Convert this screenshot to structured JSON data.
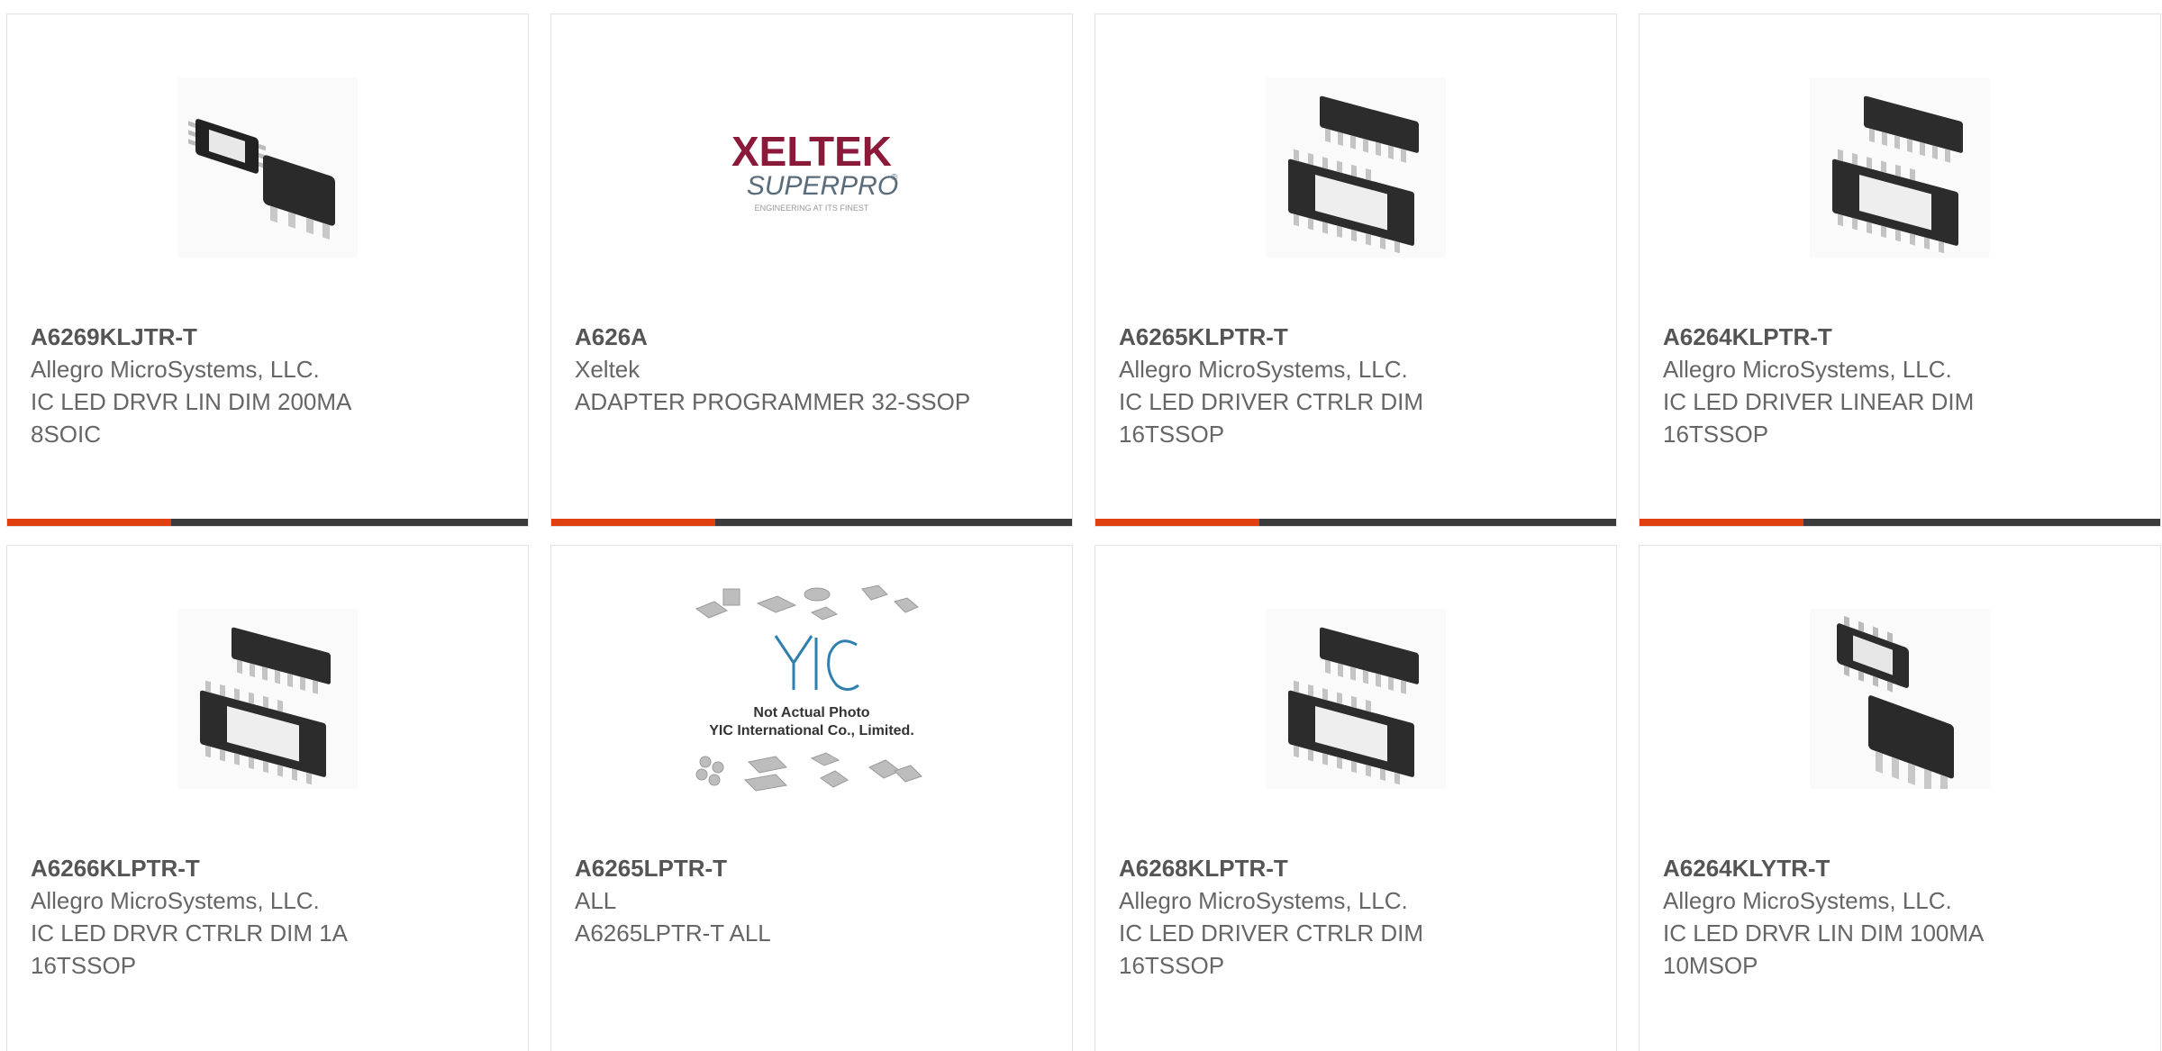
{
  "products": [
    {
      "part": "A6269KLJTR-T",
      "manufacturer": "Allegro MicroSystems, LLC.",
      "description": "IC LED DRVR LIN DIM 200MA 8SOIC",
      "image": "soic-8-chip"
    },
    {
      "part": "A626A",
      "manufacturer": "Xeltek",
      "description": "ADAPTER PROGRAMMER 32-SSOP",
      "image": "xeltek-logo",
      "logo": {
        "brand": "XELTEK",
        "sub": "SUPERPRO",
        "reg": "®",
        "tagline": "ENGINEERING AT ITS FINEST"
      }
    },
    {
      "part": "A6265KLPTR-T",
      "manufacturer": "Allegro MicroSystems, LLC.",
      "description": "IC LED DRIVER CTRLR DIM 16TSSOP",
      "image": "tssop-16-chip"
    },
    {
      "part": "A6264KLPTR-T",
      "manufacturer": "Allegro MicroSystems, LLC.",
      "description": "IC LED DRIVER LINEAR DIM 16TSSOP",
      "image": "tssop-16-chip"
    },
    {
      "part": "A6266KLPTR-T",
      "manufacturer": "Allegro MicroSystems, LLC.",
      "description": "IC LED DRVR CTRLR DIM 1A 16TSSOP",
      "image": "tssop-16-chip"
    },
    {
      "part": "A6265LPTR-T",
      "manufacturer": "ALL",
      "description": "A6265LPTR-T ALL",
      "image": "yic-placeholder",
      "placeholder": {
        "logo": "YIC",
        "line1": "Not Actual Photo",
        "line2": "YIC International Co., Limited."
      }
    },
    {
      "part": "A6268KLPTR-T",
      "manufacturer": "Allegro MicroSystems, LLC.",
      "description": "IC LED DRIVER CTRLR DIM 16TSSOP",
      "image": "tssop-16-chip"
    },
    {
      "part": "A6264KLYTR-T",
      "manufacturer": "Allegro MicroSystems, LLC.",
      "description": "IC LED DRVR LIN DIM 100MA 10MSOP",
      "image": "msop-10-chip"
    }
  ],
  "colors": {
    "accent": "#e0400f",
    "bar": "#3b3b3b",
    "text": "#666666"
  }
}
